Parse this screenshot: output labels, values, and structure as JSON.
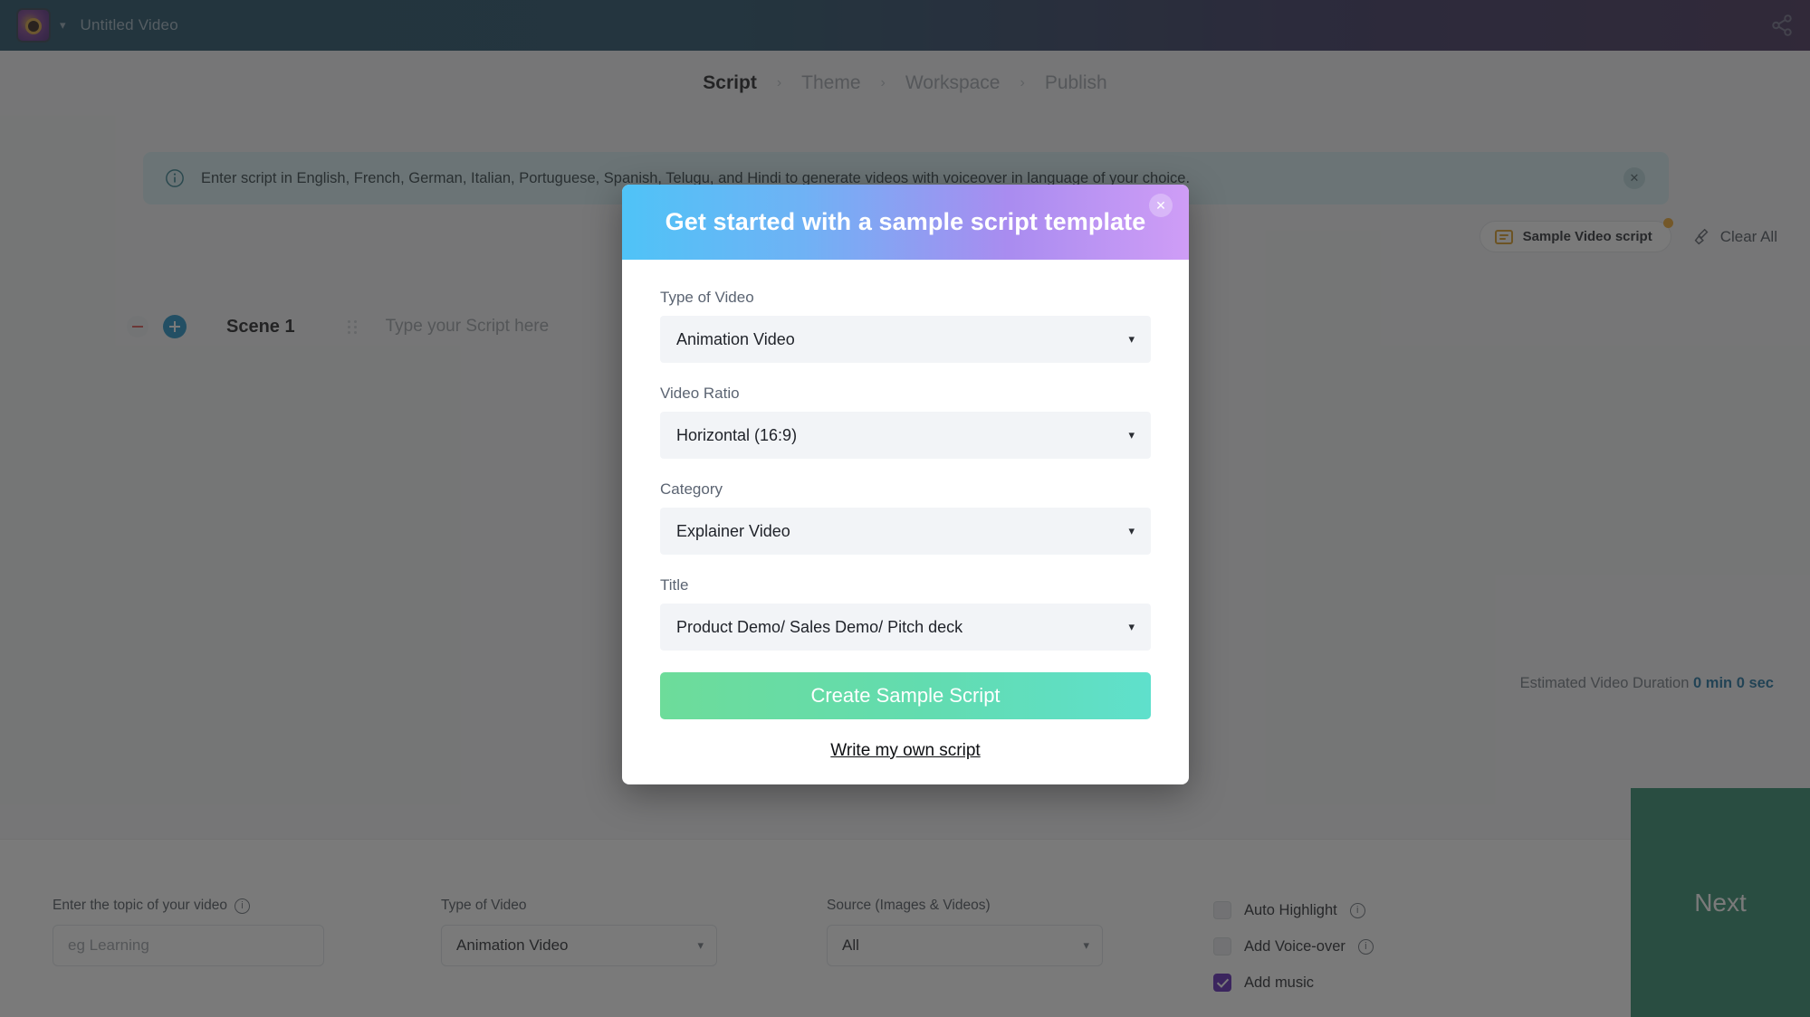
{
  "topbar": {
    "project_title": "Untitled Video",
    "logo_icon": "app-logo-icon",
    "chevron_icon": "chevron-down-icon",
    "share_icon": "share-icon"
  },
  "steps": [
    {
      "label": "Script",
      "active": true
    },
    {
      "label": "Theme",
      "active": false
    },
    {
      "label": "Workspace",
      "active": false
    },
    {
      "label": "Publish",
      "active": false
    }
  ],
  "step_separator": "›",
  "banner": {
    "icon": "info-circle-icon",
    "text": "Enter script in English, French, German, Italian, Portuguese, Spanish, Telugu, and Hindi to generate videos with voiceover in language of your choice.",
    "close_icon": "close-icon"
  },
  "toolbar": {
    "sample_button_label": "Sample Video script",
    "sample_icon": "script-lines-icon",
    "notification_dot": true,
    "clear_all_label": "Clear All",
    "clear_icon": "broom-icon"
  },
  "scene": {
    "remove_icon": "minus-circle-icon",
    "add_icon": "plus-circle-icon",
    "name": "Scene 1",
    "drag_icon": "drag-handle-icon",
    "script_placeholder": "Type your Script here"
  },
  "estimated": {
    "label": "Estimated Video Duration",
    "value": "0 min 0 sec"
  },
  "bottom": {
    "topic": {
      "label": "Enter the topic of your video",
      "info_icon": "info-circle-icon",
      "placeholder": "eg Learning"
    },
    "type_of_video": {
      "label": "Type of Video",
      "value": "Animation Video",
      "caret_icon": "chevron-down-icon"
    },
    "source": {
      "label": "Source (Images & Videos)",
      "value": "All",
      "caret_icon": "chevron-down-icon"
    },
    "checkboxes": [
      {
        "label": "Auto Highlight",
        "checked": false,
        "info_icon": "info-circle-icon"
      },
      {
        "label": "Add Voice-over",
        "checked": false,
        "info_icon": "info-circle-icon"
      },
      {
        "label": "Add music",
        "checked": true,
        "info_icon": null
      }
    ],
    "next_label": "Next"
  },
  "modal": {
    "title": "Get started with a sample script template",
    "close_icon": "close-icon",
    "fields": [
      {
        "label": "Type of Video",
        "value": "Animation Video",
        "caret_icon": "chevron-down-icon"
      },
      {
        "label": "Video Ratio",
        "value": "Horizontal (16:9)",
        "caret_icon": "chevron-down-icon"
      },
      {
        "label": "Category",
        "value": "Explainer Video",
        "caret_icon": "chevron-down-icon"
      },
      {
        "label": "Title",
        "value": "Product Demo/ Sales Demo/ Pitch deck",
        "caret_icon": "chevron-down-icon"
      }
    ],
    "primary_button": "Create Sample Script",
    "secondary_link": "Write my own script"
  },
  "colors": {
    "modal_header_from": "#4fc3f7",
    "modal_header_to": "#cf9df6",
    "primary_button_from": "#6ddc9a",
    "primary_button_to": "#5fe0cc",
    "next_button": "#2b8a6a",
    "checkbox_checked": "#5b21b6",
    "accent_orange": "#f0a72a",
    "duration_value": "#1a6e9e"
  }
}
